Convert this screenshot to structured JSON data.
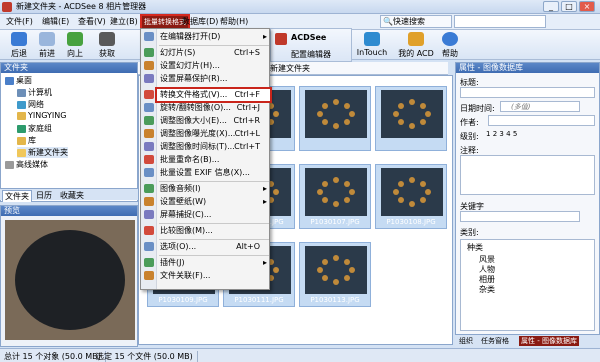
{
  "window": {
    "title": "新建文件夹 - ACDSee 8 相片管理器",
    "min": "_",
    "max": "□",
    "close": "×"
  },
  "menubar": {
    "items": [
      "文件(F)",
      "编辑(E)",
      "查看(V)",
      "建立(B)",
      "数据库(D)",
      "帮助(H)"
    ],
    "active": "批量转换格式",
    "quick_search": "快速搜索",
    "search_value": ""
  },
  "toolbar": {
    "items": [
      "后退",
      "前进",
      "向上",
      "获取",
      "ACDSee",
      "配置编辑器",
      "InTouch",
      "我的 ACD",
      "帮助"
    ]
  },
  "left": {
    "folders_title": "文件夹",
    "tree": [
      "桌面",
      "计算机",
      "网络",
      "YINGYING",
      "家庭组",
      "库",
      "新建文件夹",
      "高线媒体"
    ],
    "tabs": [
      "文件夹",
      "日历",
      "收藏夹"
    ],
    "preview_title": "预览"
  },
  "path": {
    "text": "新建文件夹"
  },
  "files": [
    {
      "name": ""
    },
    {
      "name": ""
    },
    {
      "name": ""
    },
    {
      "name": ""
    },
    {
      "name": "P1030103.JPG"
    },
    {
      "name": "P1030104.JPG"
    },
    {
      "name": "P1030107.JPG"
    },
    {
      "name": "P1030108.JPG"
    },
    {
      "name": "P1030109.JPG"
    },
    {
      "name": "P1030111.JPG"
    },
    {
      "name": "P1030113.JPG"
    }
  ],
  "props": {
    "title": "属性 - 图像数据库",
    "fields": [
      "标题:",
      "日期时间:",
      "作者:",
      "级别:",
      "注释:",
      "关键字",
      "类别:"
    ],
    "date_placeholder": "(多值)",
    "rating_values": [
      "1",
      "2",
      "3",
      "4",
      "5"
    ],
    "categories_root": "种类",
    "categories": [
      "风景",
      "人物",
      "相册",
      "杂类"
    ],
    "tabs": [
      "组织",
      "任务窗格",
      "属性 - 图像数据库"
    ]
  },
  "status": {
    "total": "总计 15 个对象 (50.0 MB)",
    "selected": "选定 15 个文件 (50.0 MB)"
  },
  "context_menu": {
    "items": [
      {
        "label": "在编辑器打开(D)",
        "shortcut": "",
        "submenu": true
      },
      {
        "label": "幻灯片(S)",
        "shortcut": "Ctrl+S",
        "submenu": false
      },
      {
        "label": "设置幻灯片(H)...",
        "shortcut": "",
        "submenu": false
      },
      {
        "label": "设置屏幕保护(R)...",
        "shortcut": "",
        "submenu": false
      },
      {
        "label": "转换文件格式(V)...",
        "shortcut": "Ctrl+F",
        "submenu": false,
        "highlight": true
      },
      {
        "label": "旋转/翻转图像(O)...",
        "shortcut": "Ctrl+J",
        "submenu": false
      },
      {
        "label": "调整图像大小(E)...",
        "shortcut": "Ctrl+R",
        "submenu": false
      },
      {
        "label": "调整图像曝光度(X)...",
        "shortcut": "Ctrl+L",
        "submenu": false
      },
      {
        "label": "调整图像时间标(T)...",
        "shortcut": "Ctrl+T",
        "submenu": false
      },
      {
        "label": "批量重命名(B)...",
        "shortcut": "",
        "submenu": false
      },
      {
        "label": "批量设置 EXIF 信息(X)...",
        "shortcut": "",
        "submenu": false
      },
      {
        "label": "图像音频(I)",
        "shortcut": "",
        "submenu": true
      },
      {
        "label": "设置壁纸(W)",
        "shortcut": "",
        "submenu": true
      },
      {
        "label": "屏幕捕捉(C)...",
        "shortcut": "",
        "submenu": false
      },
      {
        "label": "比较图像(M)...",
        "shortcut": "",
        "submenu": false
      },
      {
        "label": "选项(O)...",
        "shortcut": "Alt+O",
        "submenu": false
      },
      {
        "label": "插件(J)",
        "shortcut": "",
        "submenu": true
      },
      {
        "label": "文件关联(F)...",
        "shortcut": "",
        "submenu": false
      }
    ]
  }
}
